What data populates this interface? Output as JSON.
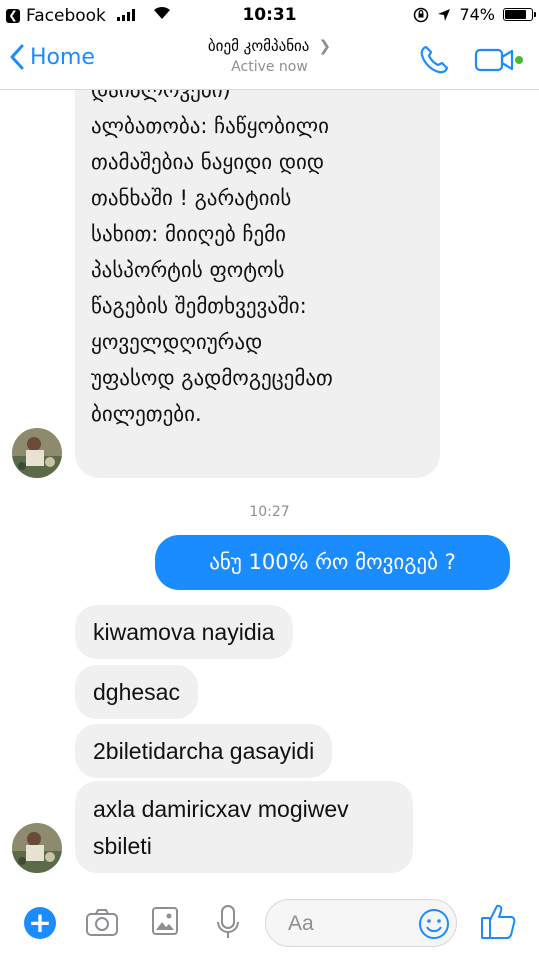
{
  "status_bar": {
    "back_app": "Facebook",
    "time": "10:31",
    "battery_percent": "74%",
    "battery_level": 0.74
  },
  "nav": {
    "back_label": "Home",
    "contact_name": "ბიემ კომპანია",
    "contact_status": "Active now"
  },
  "colors": {
    "accent": "#1a8cff",
    "incoming_bubble": "#f0f0f0",
    "active_dot": "#44bd32"
  },
  "messages": {
    "incoming_long_lines": [
      "დაიბლოკები)",
      "ალბათობა: ჩაწყობილი",
      "თამაშებია ნაყიდი დიდ",
      "თანხაში ! გარატიის",
      "სახით: მიიღებ ჩემი",
      "პასპორტის ფოტოს",
      "წაგების შემთხვევაში:",
      "ყოველდღიურად",
      "უფასოდ გადმოგეცემათ",
      "ბილეთები."
    ],
    "timestamp": "10:27",
    "outgoing": "ანუ 100% რო მოვიგებ ?",
    "incoming": [
      "kiwamova nayidia",
      "dghesac",
      "2biletidarcha gasayidi"
    ],
    "incoming_last_lines": [
      "axla damiricxav mogiwev",
      "sbileti"
    ]
  },
  "composer": {
    "placeholder": "Aa"
  }
}
